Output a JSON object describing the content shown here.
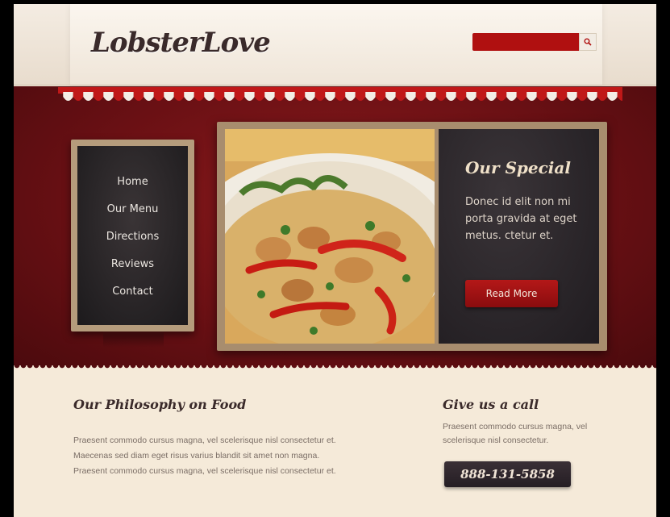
{
  "header": {
    "logo": "LobsterLove",
    "search": {
      "value": "",
      "placeholder": ""
    }
  },
  "nav": {
    "items": [
      {
        "label": "Home"
      },
      {
        "label": "Our Menu"
      },
      {
        "label": "Directions"
      },
      {
        "label": "Reviews"
      },
      {
        "label": "Contact"
      }
    ]
  },
  "special": {
    "title": "Our Special",
    "text": "Donec id elit non mi porta gravida at eget metus. ctetur et.",
    "button": "Read More"
  },
  "philosophy": {
    "title": "Our Philosophy on Food",
    "lines": [
      "Praesent commodo cursus magna, vel scelerisque nisl consectetur et.",
      "Maecenas sed diam eget risus varius blandit sit amet non magna.",
      "Praesent commodo cursus magna, vel scelerisque nisl consectetur et."
    ]
  },
  "call": {
    "title": "Give us a call",
    "text": "Praesent commodo cursus magna, vel scelerisque nisl consectetur.",
    "phone": "888-131-5858"
  },
  "colors": {
    "brand_red": "#b01010",
    "chalkboard": "#2a2528",
    "cream": "#f5ead9"
  },
  "icons": {
    "search": "search-icon"
  }
}
